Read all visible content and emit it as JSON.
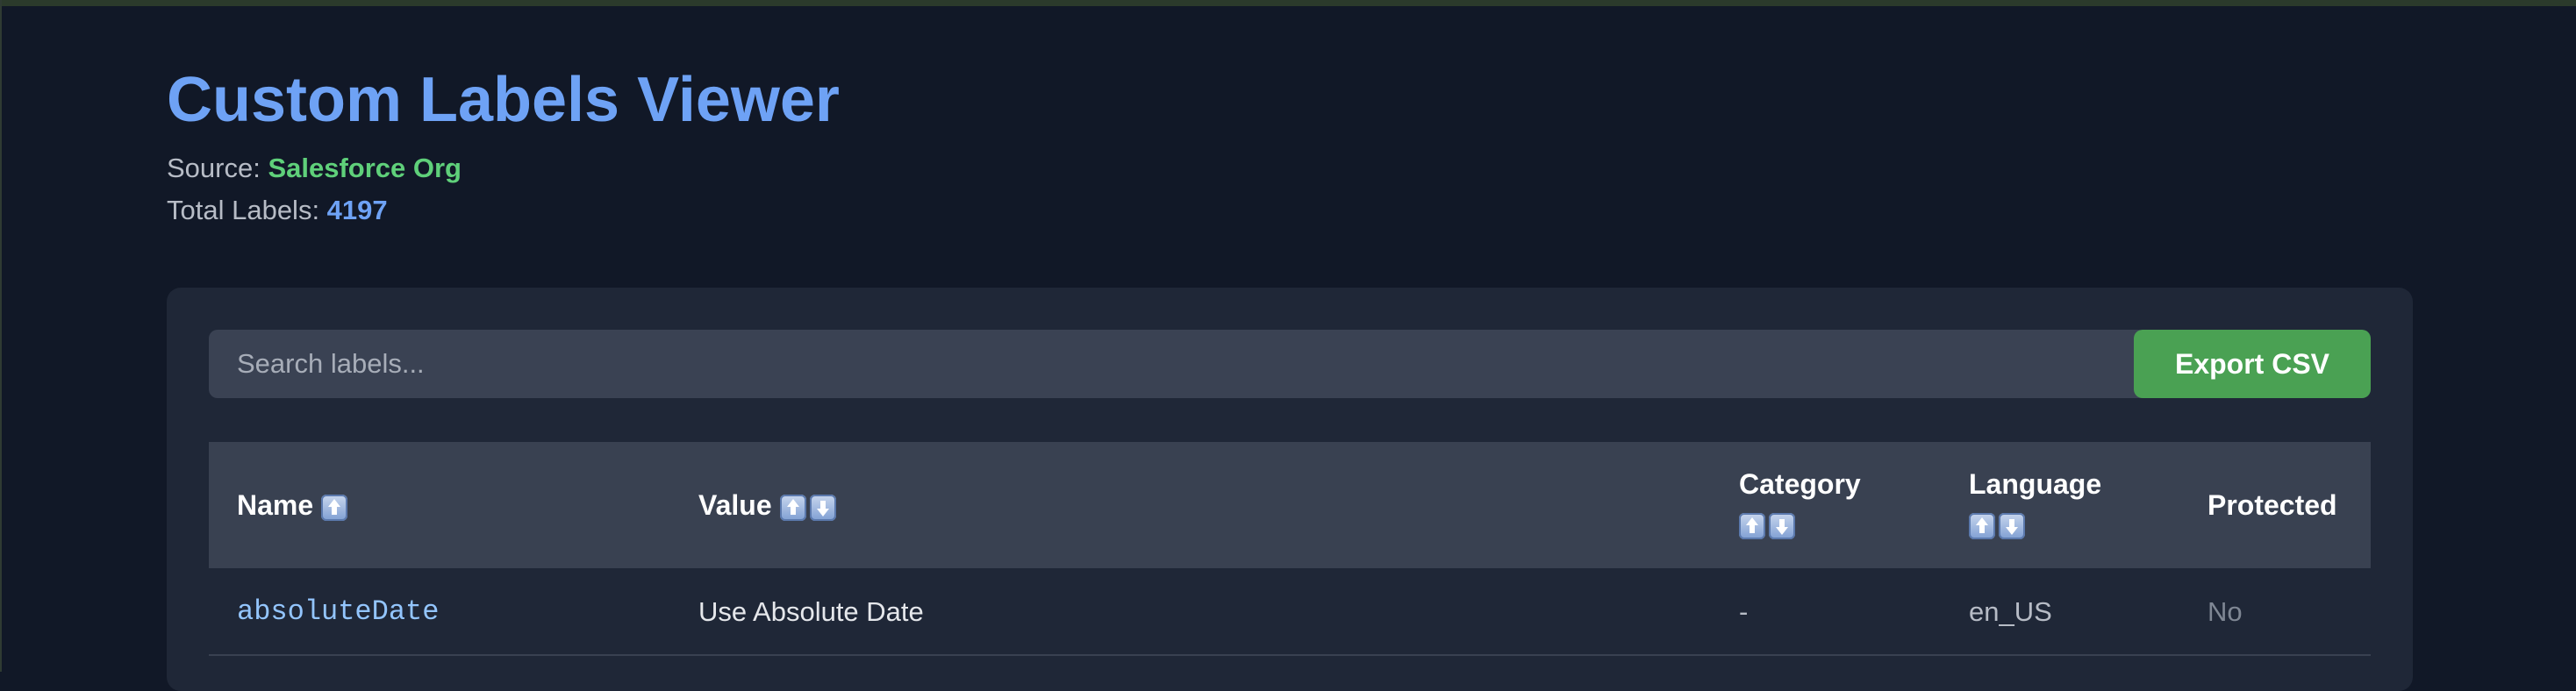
{
  "header": {
    "title": "Custom Labels Viewer",
    "source_label": "Source: ",
    "source_value": "Salesforce Org",
    "total_label": "Total Labels: ",
    "total_value": "4197"
  },
  "toolbar": {
    "search_placeholder": "Search labels...",
    "search_value": "",
    "export_label": "Export CSV"
  },
  "table": {
    "columns": [
      {
        "label": "Name",
        "sort_icons": [
          "up-arrow-icon"
        ]
      },
      {
        "label": "Value",
        "sort_icons": [
          "up-arrow-icon",
          "down-arrow-icon"
        ]
      },
      {
        "label": "Category",
        "sort_icons": [
          "up-arrow-icon",
          "down-arrow-icon"
        ]
      },
      {
        "label": "Language",
        "sort_icons": [
          "up-arrow-icon",
          "down-arrow-icon"
        ]
      },
      {
        "label": "Protected",
        "sort_icons": []
      }
    ],
    "rows": [
      {
        "name": "absoluteDate",
        "value": "Use Absolute Date",
        "category": "-",
        "language": "en_US",
        "protected": "No"
      }
    ]
  },
  "colors": {
    "background": "#111827",
    "title": "#6ea2f5",
    "source": "#5fd07a",
    "export_button": "#4aa153",
    "table_header": "#394151",
    "card": "#1f2737"
  }
}
